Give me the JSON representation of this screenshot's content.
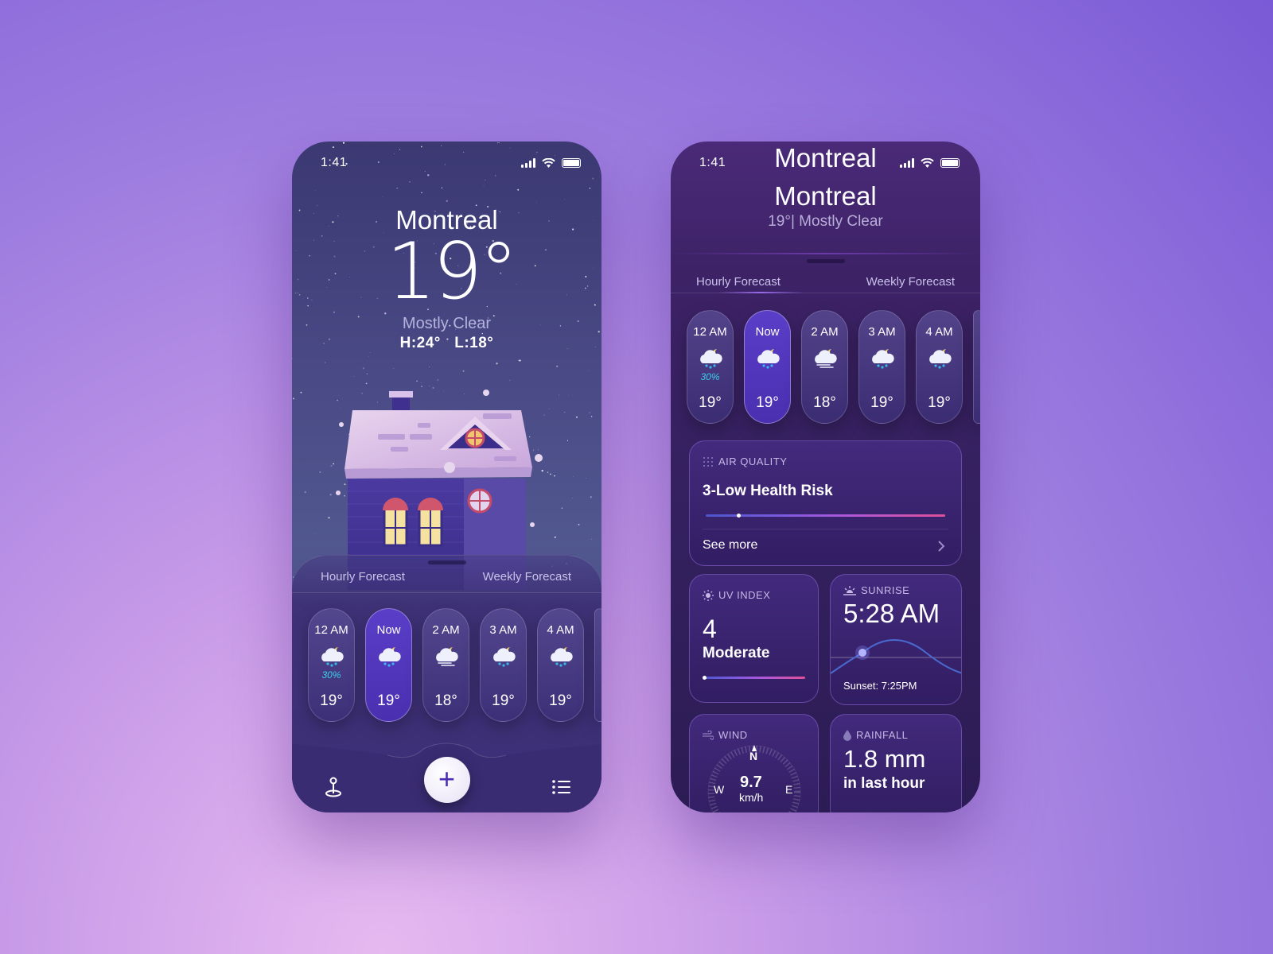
{
  "phone_left": {
    "status": {
      "time": "1:41"
    },
    "city": "Montreal",
    "temperature": "19°",
    "condition": "Mostly Clear",
    "high_low": "H:24°   L:18°",
    "tabs": {
      "hourly": "Hourly Forecast",
      "weekly": "Weekly Forecast"
    },
    "hourly": [
      {
        "time": "12 AM",
        "precip": "30%",
        "temp": "19°",
        "icon": "cloud-rain-moon-icon"
      },
      {
        "time": "Now",
        "precip": "",
        "temp": "19°",
        "icon": "cloud-rain-moon-icon",
        "active": true
      },
      {
        "time": "2 AM",
        "precip": "",
        "temp": "18°",
        "icon": "cloud-wind-moon-icon"
      },
      {
        "time": "3 AM",
        "precip": "",
        "temp": "19°",
        "icon": "cloud-rain-moon-icon"
      },
      {
        "time": "4 AM",
        "precip": "",
        "temp": "19°",
        "icon": "cloud-rain-moon-icon"
      }
    ],
    "add_label": "+"
  },
  "phone_right": {
    "status": {
      "time": "1:41"
    },
    "top_city": "Montreal",
    "city": "Montreal",
    "subtitle": "19°| Mostly Clear",
    "tabs": {
      "hourly": "Hourly Forecast",
      "weekly": "Weekly Forecast"
    },
    "hourly": [
      {
        "time": "12 AM",
        "precip": "30%",
        "temp": "19°"
      },
      {
        "time": "Now",
        "precip": "",
        "temp": "19°"
      },
      {
        "time": "2 AM",
        "precip": "",
        "temp": "18°"
      },
      {
        "time": "3 AM",
        "precip": "",
        "temp": "19°"
      },
      {
        "time": "4 AM",
        "precip": "",
        "temp": "19°"
      }
    ],
    "air_quality": {
      "label": "AIR QUALITY",
      "value": "3-Low Health Risk",
      "see_more": "See more",
      "level": 0.13
    },
    "uv": {
      "label": "UV INDEX",
      "value": "4",
      "desc": "Moderate",
      "level": 0.0
    },
    "sunrise": {
      "label": "SUNRISE",
      "value": "5:28 AM",
      "sunset": "Sunset: 7:25PM"
    },
    "wind": {
      "label": "WIND",
      "speed": "9.7",
      "unit": "km/h",
      "n": "N",
      "e": "E",
      "w": "W"
    },
    "rainfall": {
      "label": "RAINFALL",
      "value": "1.8 mm",
      "desc": "in last hour"
    }
  },
  "colors": {
    "accent": "#4c2fb4",
    "precip": "#39d0ea"
  }
}
